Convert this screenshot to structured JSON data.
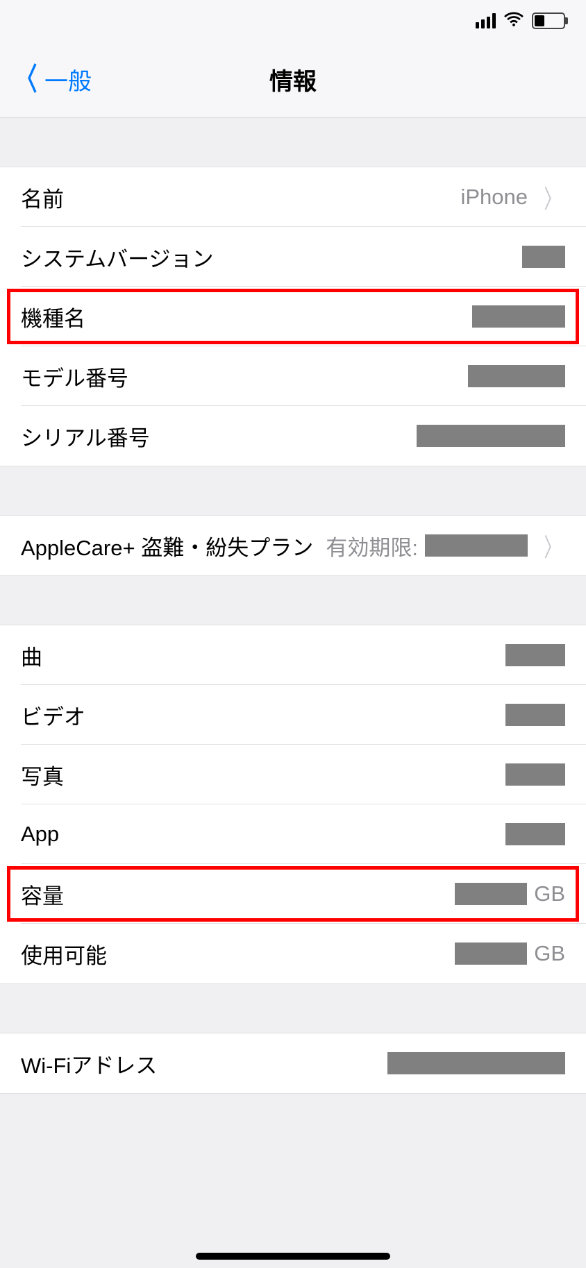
{
  "statusBar": {
    "signal": 4,
    "wifi": true,
    "batteryLevelPercent": 35
  },
  "header": {
    "backLabel": "一般",
    "title": "情報"
  },
  "group1": {
    "name": {
      "label": "名前",
      "value": "iPhone"
    },
    "systemVersion": {
      "label": "システムバージョン"
    },
    "modelName": {
      "label": "機種名"
    },
    "modelNumber": {
      "label": "モデル番号"
    },
    "serialNumber": {
      "label": "シリアル番号"
    }
  },
  "group2": {
    "applecare": {
      "label": "AppleCare+ 盗難・紛失プラン",
      "sub": "有効期限:"
    }
  },
  "group3": {
    "songs": {
      "label": "曲"
    },
    "videos": {
      "label": "ビデオ"
    },
    "photos": {
      "label": "写真"
    },
    "apps": {
      "label": "App"
    },
    "capacity": {
      "label": "容量",
      "unit": "GB"
    },
    "available": {
      "label": "使用可能",
      "unit": "GB"
    }
  },
  "group4": {
    "wifiAddress": {
      "label": "Wi-Fiアドレス"
    }
  }
}
